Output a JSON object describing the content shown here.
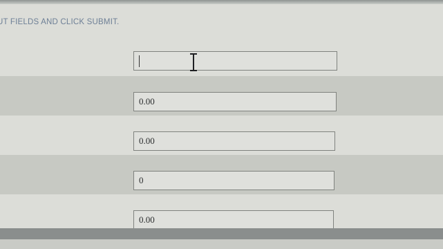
{
  "instruction": "UT FIELDS AND CLICK SUBMIT.",
  "fields": [
    {
      "value": ""
    },
    {
      "value": "0.00"
    },
    {
      "value": "0.00"
    },
    {
      "value": "0"
    },
    {
      "value": "0.00"
    }
  ],
  "cursor_icon": "text-ibeam-cursor-icon"
}
